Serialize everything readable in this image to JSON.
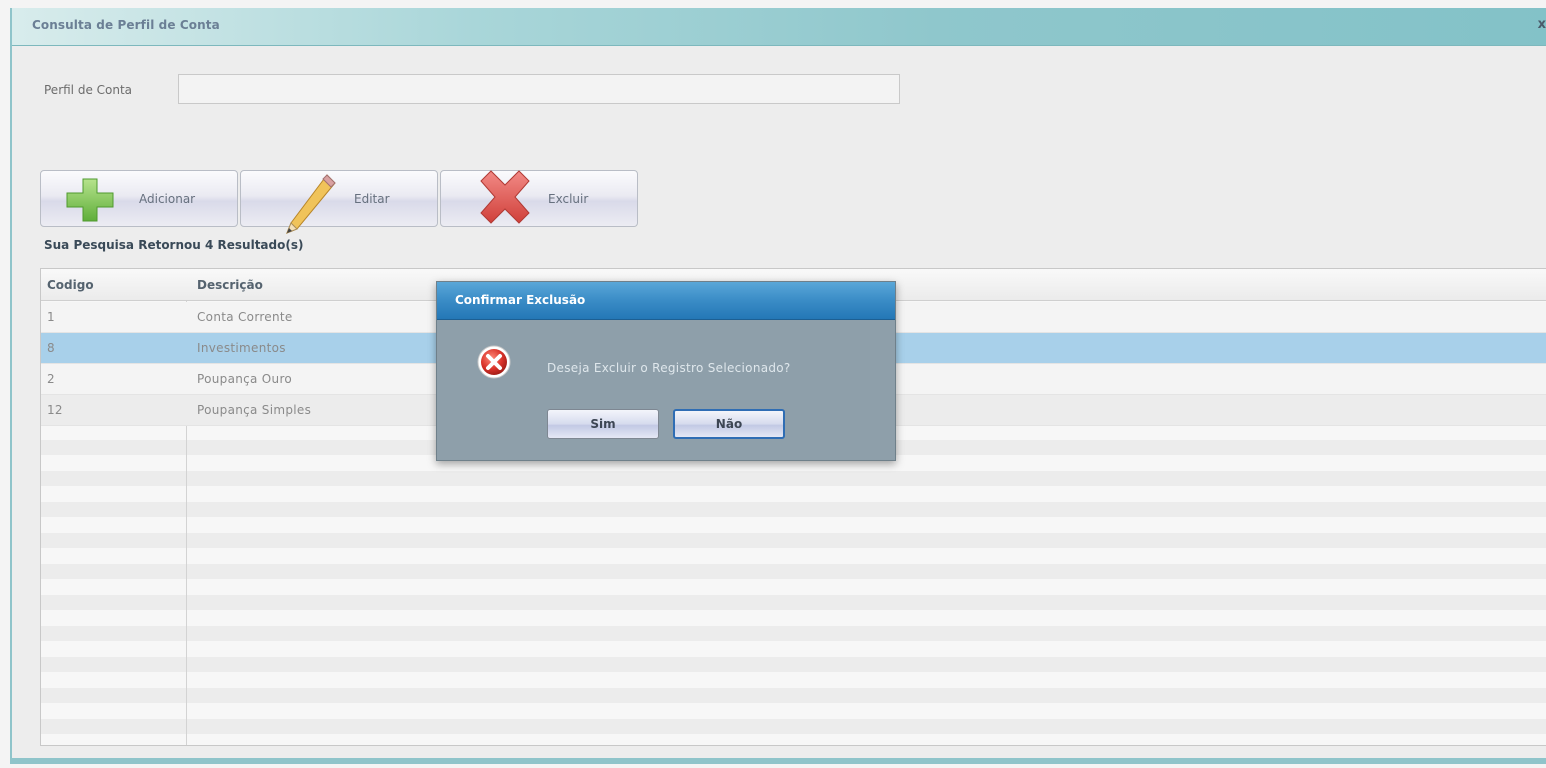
{
  "window": {
    "title": "Consulta de Perfil de Conta",
    "close_glyph": "x"
  },
  "search": {
    "label": "Perfil de Conta",
    "value": "",
    "placeholder": ""
  },
  "toolbar": {
    "add_label": "Adicionar",
    "add_icon": "plus-icon",
    "edit_label": "Editar",
    "edit_icon": "pencil-icon",
    "delete_label": "Excluir",
    "delete_icon": "x-icon"
  },
  "results": {
    "count_text": "Sua Pesquisa Retornou 4 Resultado(s)"
  },
  "grid": {
    "columns": [
      "Codigo",
      "Descrição"
    ],
    "rows": [
      {
        "codigo": "1",
        "descricao": "Conta Corrente"
      },
      {
        "codigo": "8",
        "descricao": "Investimentos",
        "selected": true
      },
      {
        "codigo": "2",
        "descricao": "Poupança Ouro"
      },
      {
        "codigo": "12",
        "descricao": "Poupança Simples"
      }
    ]
  },
  "dialog": {
    "title": "Confirmar Exclusão",
    "icon": "error-icon",
    "message": "Deseja Excluir o Registro Selecionado?",
    "yes_label": "Sim",
    "no_label": "Não"
  },
  "colors": {
    "titlebar": "#8fc7cc",
    "selected_row": "#a8d0ea",
    "dialog_title": "#3a8cc6",
    "dialog_body": "#8e9faa"
  }
}
